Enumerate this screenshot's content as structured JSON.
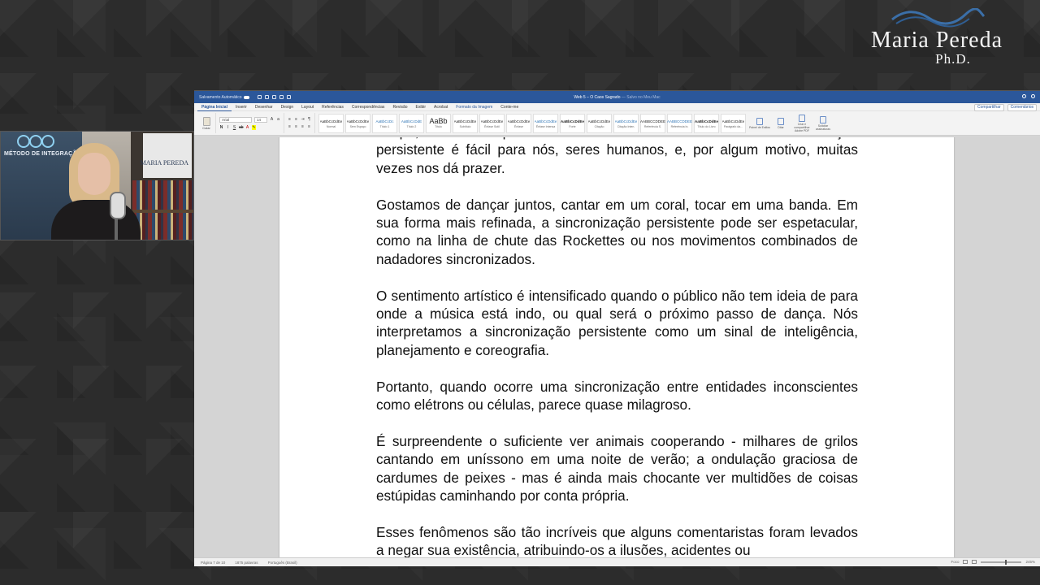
{
  "brand": {
    "name": "Maria Pereda",
    "degree": "Ph.D.",
    "wave_color": "#3b6fa8"
  },
  "webcam": {
    "logo_text": "MÉTODO DE INTEGRAÇÃO",
    "poster_text": "MARIA PEREDA"
  },
  "word": {
    "titlebar": {
      "autosave_label": "Salvamento Automático",
      "doc_title": "Web 5 – O Caos Sagrado",
      "doc_subtitle": "— Salvo no Meu Mac"
    },
    "tabs": [
      "Página Inicial",
      "Inserir",
      "Desenhar",
      "Design",
      "Layout",
      "Referências",
      "Correspondências",
      "Revisão",
      "Exibir",
      "Acrobat",
      "Formato da Imagem",
      "Conte-me"
    ],
    "share_label": "Compartilhar",
    "comments_label": "Comentários",
    "ribbon": {
      "paste_label": "Colar",
      "font_name": "Arial",
      "font_size": "14",
      "styles": [
        {
          "preview": "AaBbCcDdEe",
          "name": "Normal"
        },
        {
          "preview": "AaBbCcDdEe",
          "name": "Sem Espaço"
        },
        {
          "preview": "AaBbCcDc",
          "name": "Título 1"
        },
        {
          "preview": "AaBbCcDdE",
          "name": "Título 2"
        },
        {
          "preview": "AaBb",
          "name": "Título"
        },
        {
          "preview": "AaBbCcDdEe",
          "name": "Subtítulo"
        },
        {
          "preview": "AaBbCcDdEe",
          "name": "Ênfase Sutil"
        },
        {
          "preview": "AaBbCcDdEe",
          "name": "Ênfase"
        },
        {
          "preview": "AaBbCcDdEe",
          "name": "Ênfase Intensa"
        },
        {
          "preview": "AaBbCcDdEe",
          "name": "Forte"
        },
        {
          "preview": "AaBbCcDdEe",
          "name": "Citação"
        },
        {
          "preview": "AaBbCcDdEe",
          "name": "Citação Inten."
        },
        {
          "preview": "AABBCCDDEE",
          "name": "Referência S."
        },
        {
          "preview": "AABBCCDDEE",
          "name": "Referência In."
        },
        {
          "preview": "AaBbCcDdEe",
          "name": "Título do Livro"
        },
        {
          "preview": "AaBbCcDdEe",
          "name": "Parágrafo da..."
        }
      ],
      "tools": [
        {
          "label": "Painel de Estilos"
        },
        {
          "label": "Ditar"
        },
        {
          "label": "Criar e compartilhar Adobe PDF"
        },
        {
          "label": "Solicitar assinaturas"
        }
      ]
    },
    "document": {
      "paragraphs": [
        "tempo, a sincronia provavelmente não é um acidente. Essa sincronização persistente é fácil para nós, seres humanos, e, por algum motivo, muitas vezes nos dá prazer.",
        "Gostamos de dançar juntos, cantar em um coral, tocar em uma banda. Em sua forma mais refinada, a sincronização persistente pode ser espetacular, como na linha de chute das Rockettes ou nos movimentos combinados de nadadores sincronizados.",
        "O sentimento artístico é intensificado quando o público não tem ideia de para onde a música está indo, ou qual será o próximo passo de dança. Nós interpretamos a sincronização persistente como um sinal de inteligência, planejamento e coreografia.",
        "Portanto, quando ocorre uma sincronização entre entidades inconscientes como elétrons ou células, parece quase milagroso.",
        "É surpreendente o suficiente ver animais cooperando - milhares de grilos cantando em uníssono em uma noite de verão; a ondulação graciosa de cardumes de peixes - mas é ainda mais chocante ver multidões de coisas estúpidas caminhando por conta própria.",
        "Esses fenômenos são tão incríveis que alguns comentaristas foram levados a negar sua existência, atribuindo-os a ilusões, acidentes ou"
      ]
    },
    "statusbar": {
      "page": "Página 7 de 10",
      "words": "1875 palavras",
      "language": "Português (Brasil)",
      "focus": "Foco",
      "zoom": "245%"
    }
  }
}
